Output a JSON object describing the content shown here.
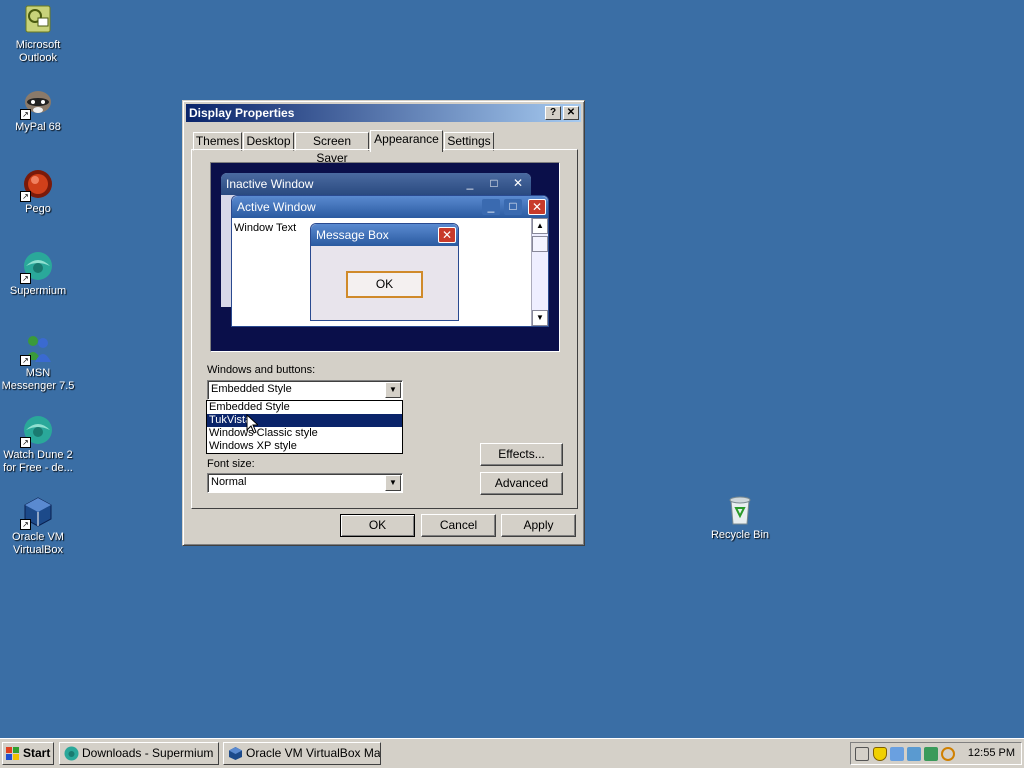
{
  "desktop": {
    "icons": [
      {
        "label": "Microsoft Outlook"
      },
      {
        "label": "MyPal 68"
      },
      {
        "label": "Pego"
      },
      {
        "label": "Supermium"
      },
      {
        "label": "MSN Messenger 7.5"
      },
      {
        "label": "Watch Dune 2 for Free - de..."
      },
      {
        "label": "Oracle VM VirtualBox"
      },
      {
        "label": "Recycle Bin"
      }
    ]
  },
  "window": {
    "title": "Display Properties",
    "help_btn": "?",
    "close_btn": "✕",
    "tabs": [
      "Themes",
      "Desktop",
      "Screen Saver",
      "Appearance",
      "Settings"
    ],
    "active_tab": "Appearance",
    "preview": {
      "inactive_title": "Inactive Window",
      "active_title": "Active Window",
      "window_text": "Window Text",
      "msgbox_title": "Message Box",
      "msgbox_ok": "OK"
    },
    "windows_buttons_label": "Windows and buttons:",
    "windows_buttons_value": "Embedded Style",
    "dropdown_options": [
      "Embedded Style",
      "TukVista",
      "Windows Classic style",
      "Windows XP style"
    ],
    "dropdown_selected": "TukVista",
    "font_size_label": "Font size:",
    "font_size_value": "Normal",
    "effects_btn": "Effects...",
    "advanced_btn": "Advanced",
    "ok_btn": "OK",
    "cancel_btn": "Cancel",
    "apply_btn": "Apply"
  },
  "taskbar": {
    "start": "Start",
    "tasks": [
      "Downloads - Supermium",
      "Oracle VM VirtualBox Ma..."
    ],
    "clock": "12:55 PM"
  }
}
